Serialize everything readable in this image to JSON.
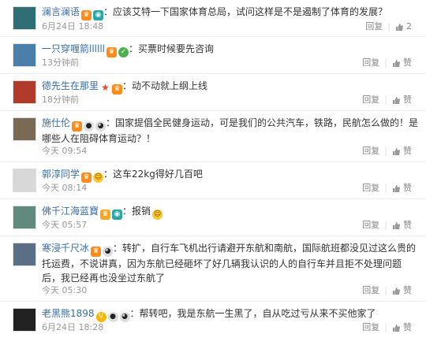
{
  "reply_label": "回复",
  "like_label": "赞",
  "comments": [
    {
      "username": "澜言澜语",
      "badges": [
        "member-icon",
        "teal-icon"
      ],
      "text": "：应该艾特一下国家体育总局，试问这样是不是遏制了体育的发展？",
      "time": "6月24日 18:48",
      "like_text": "2",
      "avatar_color": "#2f6f73"
    },
    {
      "username": "一只穿喱箭llllll",
      "badges": [
        "member-icon",
        "green-icon"
      ],
      "text": "：买票时候要先咨询",
      "time": "13分钟前",
      "like_text": "赞",
      "avatar_color": "#4a7faa"
    },
    {
      "username": "德先生在那里",
      "badges": [
        "star-icon",
        "member-icon"
      ],
      "text": "：动不动就上纲上线",
      "time": "18分钟前",
      "like_text": "赞",
      "avatar_color": "#b23a2a"
    },
    {
      "username": "施仕伦",
      "badges": [
        "member-icon",
        "gray-icon",
        "panda-icon"
      ],
      "text": "：国家提倡全民健身运动，可是我们的公共汽车，铁路，民航怎么做的！是哪些人在阻碍体育运动？！",
      "time": "今天 09:54",
      "like_text": "赞",
      "avatar_color": "#7a6a55"
    },
    {
      "username": "郭淳同学",
      "badges": [
        "member-icon",
        "face-icon"
      ],
      "text": "：这车22kg得好几百吧",
      "time": "今天 08:14",
      "like_text": "赞",
      "avatar_color": "#d8d8d8"
    },
    {
      "username": "佛千江海蓝寶",
      "badges": [
        "vip-icon",
        "teal-icon"
      ],
      "text": "：报销",
      "time": "今天 05:57",
      "like_text": "赞",
      "avatar_color": "#5f8a7d"
    },
    {
      "username": "寒浸千尺冰",
      "badges": [
        "member-icon",
        "panda-icon"
      ],
      "text": "：转扩，自行车飞机出行请避开东航和南航，国际航班都没见过这么贵的托运费，不说讲真，因为东航已经砸坏了好几辆我认识的人的自行车并且拒不处理问题后，我已经再也没坐过东航了",
      "time": "今天 05:30",
      "like_text": "赞",
      "avatar_color": "#5a6f86"
    },
    {
      "username": "老黑熊1898",
      "badges": [
        "v-icon",
        "gray-icon",
        "panda-icon"
      ],
      "text": "：帮转吧，我是东航一生黑了，自从吃过亏从来不买他家了",
      "time": "6月24日 18:28",
      "like_text": "赞",
      "avatar_color": "#222222"
    }
  ]
}
